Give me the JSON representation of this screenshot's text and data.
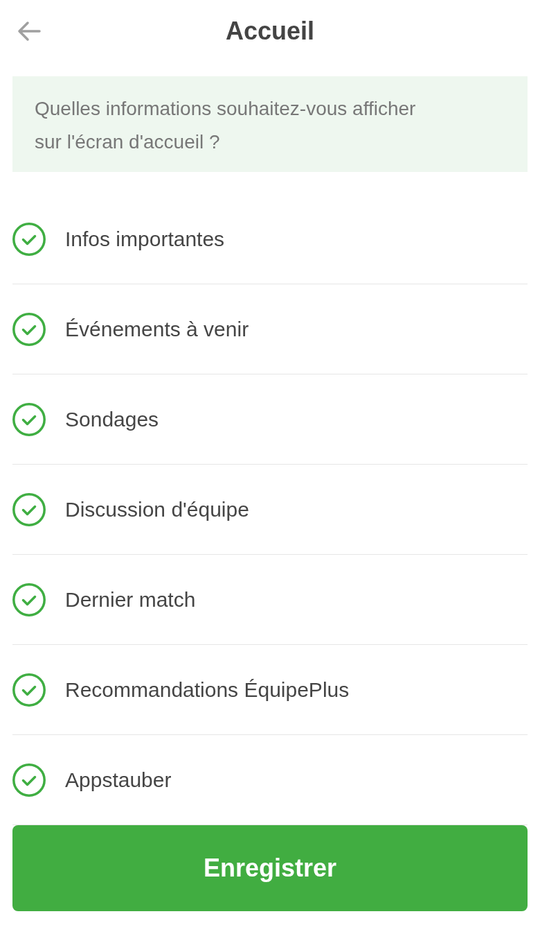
{
  "header": {
    "title": "Accueil"
  },
  "info_box": {
    "text": "Quelles informations souhaitez-vous afficher sur l'écran d'accueil ?"
  },
  "options": [
    {
      "label": "Infos importantes",
      "checked": true
    },
    {
      "label": "Événements à venir",
      "checked": true
    },
    {
      "label": "Sondages",
      "checked": true
    },
    {
      "label": "Discussion d'équipe",
      "checked": true
    },
    {
      "label": "Dernier match",
      "checked": true
    },
    {
      "label": "Recommandations ÉquipePlus",
      "checked": true
    },
    {
      "label": "Appstauber",
      "checked": true
    }
  ],
  "save_button": {
    "label": "Enregistrer"
  }
}
